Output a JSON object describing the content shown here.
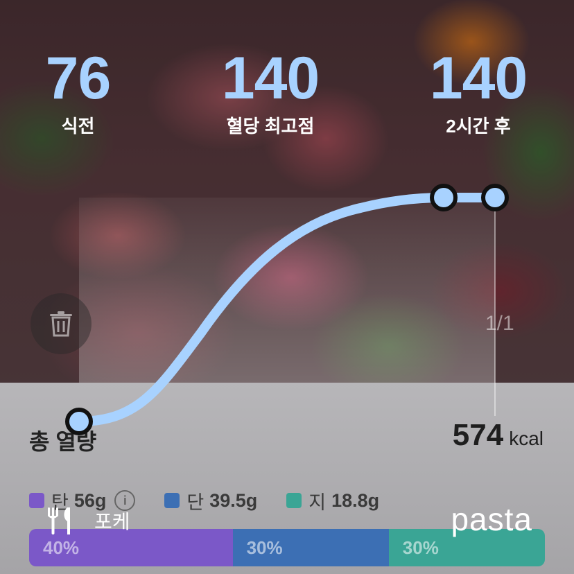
{
  "stats": [
    {
      "value": "76",
      "label": "식전"
    },
    {
      "value": "140",
      "label": "혈당 최고점"
    },
    {
      "value": "140",
      "label": "2시간 후"
    }
  ],
  "pager": "1/1",
  "summary": {
    "title": "총 열량",
    "kcal_value": "574",
    "kcal_unit": "kcal"
  },
  "macros": [
    {
      "label": "탄",
      "value": "56g",
      "color": "#7b58c8"
    },
    {
      "label": "단",
      "value": "39.5g",
      "color": "#3c6fb4"
    },
    {
      "label": "지",
      "value": "18.8g",
      "color": "#3aa595"
    }
  ],
  "ratio": [
    {
      "label": "40%",
      "percent": 40,
      "color": "#7b58c8"
    },
    {
      "label": "30%",
      "percent": 30,
      "color": "#3c6fb4"
    },
    {
      "label": "30%",
      "percent": 30,
      "color": "#3aa595"
    }
  ],
  "food": {
    "name": "포케"
  },
  "brand": "pasta",
  "curve_color": "#a8d2ff",
  "glucose_readings": [
    76,
    140,
    140
  ]
}
